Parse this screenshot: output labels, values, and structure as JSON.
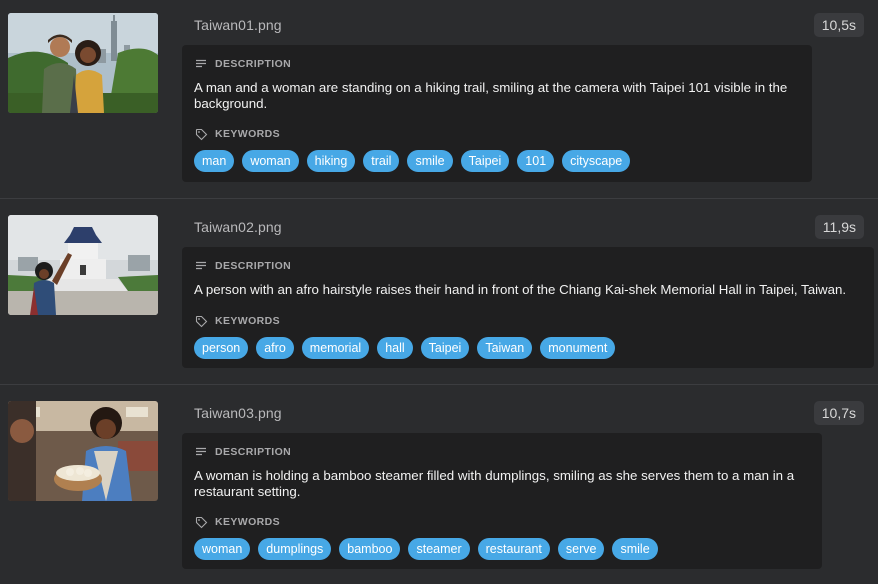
{
  "accent_color": "#47a8e6",
  "section_labels": {
    "description": "DESCRIPTION",
    "keywords": "KEYWORDS"
  },
  "icons": {
    "description": "text-lines-icon",
    "keywords": "tag-icon"
  },
  "items": [
    {
      "filename": "Taiwan01.png",
      "time": "10,5s",
      "thumbnail": "image-thumbnail",
      "description": "A man and a woman are standing on a hiking trail, smiling at the camera with Taipei 101 visible in the background.",
      "keywords": [
        "man",
        "woman",
        "hiking",
        "trail",
        "smile",
        "Taipei",
        "101",
        "cityscape"
      ]
    },
    {
      "filename": "Taiwan02.png",
      "time": "11,9s",
      "thumbnail": "image-thumbnail",
      "description": "A person with an afro hairstyle raises their hand in front of the Chiang Kai-shek Memorial Hall in Taipei, Taiwan.",
      "keywords": [
        "person",
        "afro",
        "memorial",
        "hall",
        "Taipei",
        "Taiwan",
        "monument"
      ]
    },
    {
      "filename": "Taiwan03.png",
      "time": "10,7s",
      "thumbnail": "image-thumbnail",
      "description": "A woman is holding a bamboo steamer filled with dumplings, smiling as she serves them to a man in a restaurant setting.",
      "keywords": [
        "woman",
        "dumplings",
        "bamboo",
        "steamer",
        "restaurant",
        "serve",
        "smile"
      ]
    }
  ]
}
